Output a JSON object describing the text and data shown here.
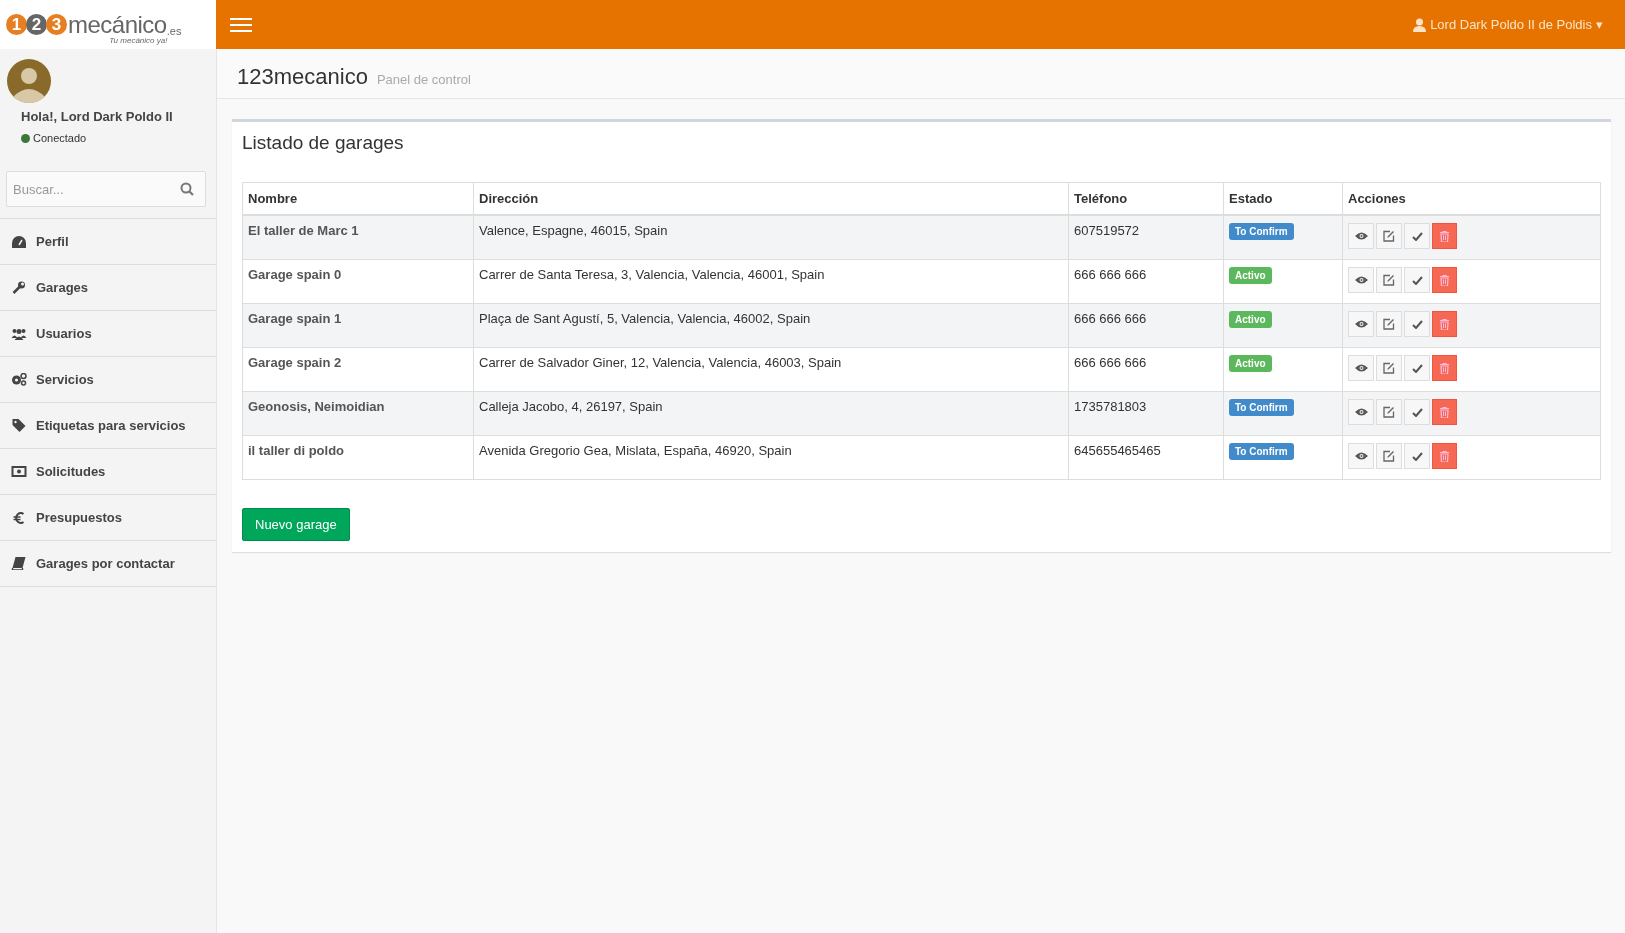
{
  "header": {
    "logo": {
      "digits": [
        "1",
        "2",
        "3"
      ],
      "word": "mecánico",
      "suffix": ".es",
      "tagline": "Tu mecánico ya!"
    },
    "user_menu": {
      "name": "Lord Dark Poldo II de Poldis",
      "caret": "▾"
    }
  },
  "sidebar": {
    "greeting": "Hola!, Lord Dark Poldo II",
    "status": {
      "label": "Conectado",
      "color": "#3c763d"
    },
    "search": {
      "placeholder": "Buscar..."
    },
    "items": [
      {
        "label": "Perfil"
      },
      {
        "label": "Garages"
      },
      {
        "label": "Usuarios"
      },
      {
        "label": "Servicios"
      },
      {
        "label": "Etiquetas para servicios"
      },
      {
        "label": "Solicitudes"
      },
      {
        "label": "Presupuestos"
      },
      {
        "label": "Garages por contactar"
      }
    ]
  },
  "page": {
    "title": "123mecanico",
    "subtitle": "Panel de control"
  },
  "box": {
    "title": "Listado de garages",
    "columns": [
      "Nombre",
      "Dirección",
      "Teléfono",
      "Estado",
      "Acciones"
    ],
    "rows": [
      {
        "name": "El taller de Marc 1",
        "address": "Valence, Espagne, 46015, Spain",
        "phone": "607519572",
        "status": {
          "label": "To Confirm",
          "color": "#428bca"
        }
      },
      {
        "name": "Garage spain 0",
        "address": "Carrer de Santa Teresa, 3, Valencia, Valencia, 46001, Spain",
        "phone": "666 666 666",
        "status": {
          "label": "Activo",
          "color": "#5cb85c"
        }
      },
      {
        "name": "Garage spain 1",
        "address": "Plaça de Sant Agustí, 5, Valencia, Valencia, 46002, Spain",
        "phone": "666 666 666",
        "status": {
          "label": "Activo",
          "color": "#5cb85c"
        }
      },
      {
        "name": "Garage spain 2",
        "address": "Carrer de Salvador Giner, 12, Valencia, Valencia, 46003, Spain",
        "phone": "666 666 666",
        "status": {
          "label": "Activo",
          "color": "#5cb85c"
        }
      },
      {
        "name": "Geonosis, Neimoidian",
        "address": "Calleja Jacobo, 4, 26197, Spain",
        "phone": "1735781803",
        "status": {
          "label": "To Confirm",
          "color": "#428bca"
        }
      },
      {
        "name": "il taller di poldo",
        "address": "Avenida Gregorio Gea, Mislata, España, 46920, Spain",
        "phone": "645655465465",
        "status": {
          "label": "To Confirm",
          "color": "#428bca"
        }
      }
    ],
    "button": "Nuevo garage"
  }
}
